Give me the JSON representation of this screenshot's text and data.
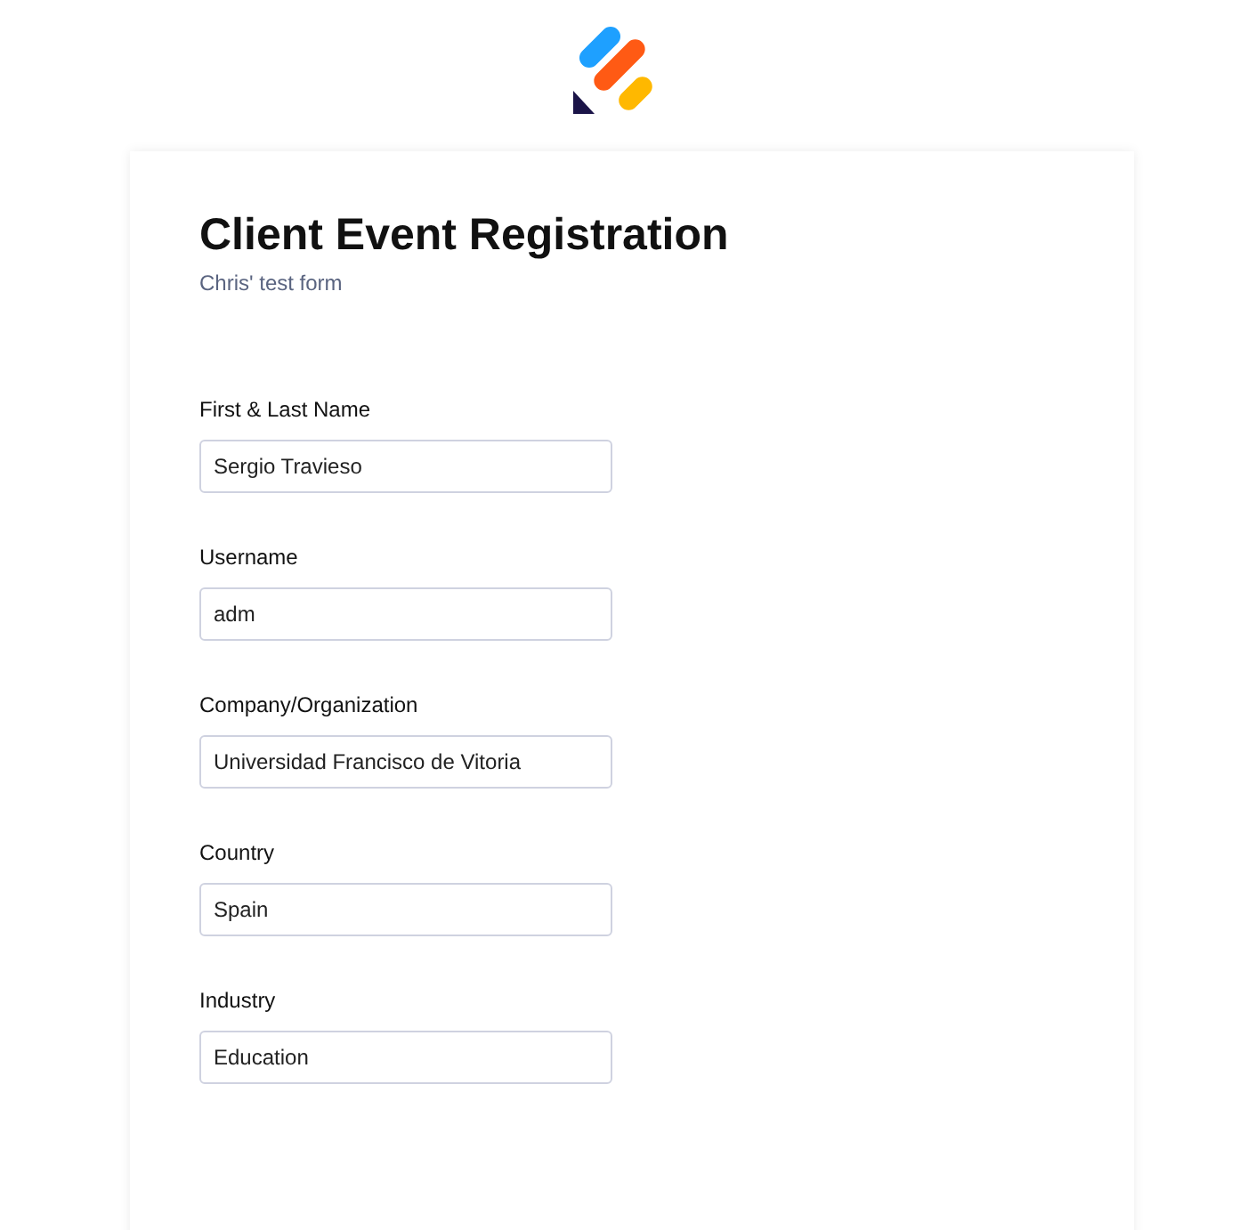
{
  "form": {
    "title": "Client Event Registration",
    "subtitle": "Chris' test form",
    "fields": [
      {
        "label": "First & Last Name",
        "value": "Sergio Travieso"
      },
      {
        "label": "Username",
        "value": "adm"
      },
      {
        "label": "Company/Organization",
        "value": "Universidad Francisco de Vitoria"
      },
      {
        "label": "Country",
        "value": "Spain"
      },
      {
        "label": "Industry",
        "value": "Education"
      }
    ]
  }
}
